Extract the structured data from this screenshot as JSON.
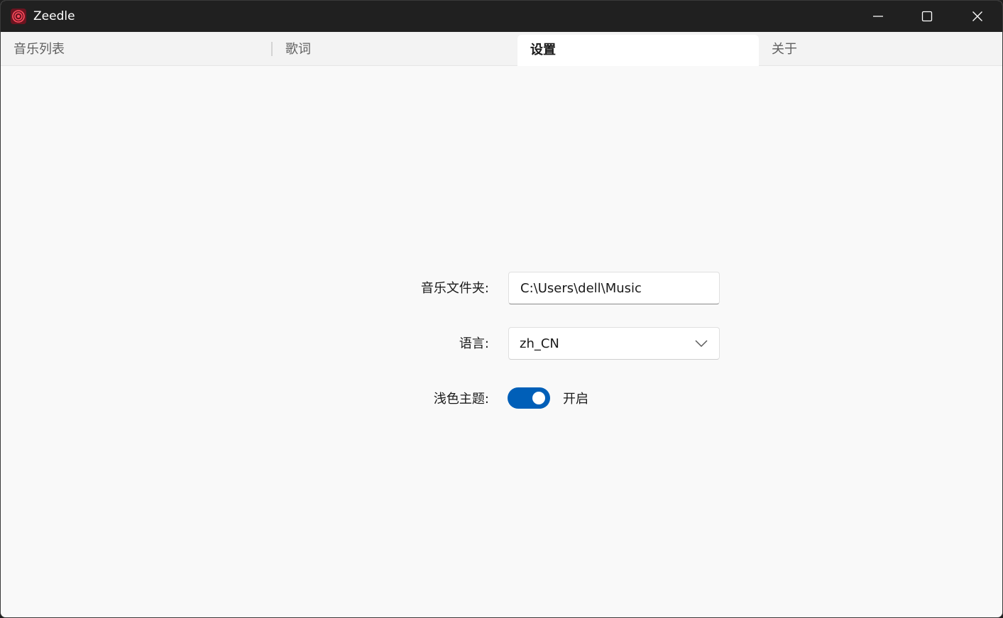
{
  "window": {
    "title": "Zeedle",
    "icon": "app-logo-icon",
    "controls": [
      "minimize-icon",
      "maximize-icon",
      "close-icon"
    ]
  },
  "tabs": [
    {
      "label": "音乐列表",
      "active": false
    },
    {
      "label": "歌词",
      "active": false
    },
    {
      "label": "设置",
      "active": true
    },
    {
      "label": "关于",
      "active": false
    }
  ],
  "settings": {
    "music_folder": {
      "label": "音乐文件夹:",
      "value": "C:\\Users\\dell\\Music"
    },
    "language": {
      "label": "语言:",
      "selected": "zh_CN"
    },
    "light_theme": {
      "label": "浅色主题:",
      "on": true,
      "state_text": "开启"
    }
  },
  "colors": {
    "accent": "#005fb8",
    "titlebar": "#202020",
    "background": "#f9f9f9"
  }
}
